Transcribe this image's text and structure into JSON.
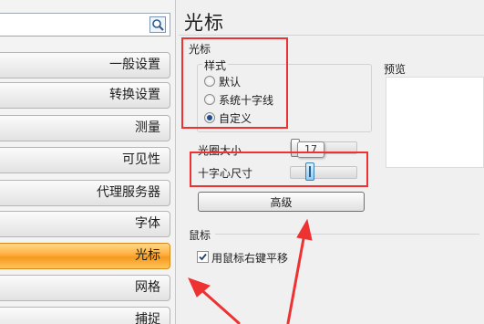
{
  "search": {
    "value": "",
    "placeholder": ""
  },
  "nav": {
    "items": [
      {
        "label": "一般设置"
      },
      {
        "label": "转换设置"
      },
      {
        "label": "测量"
      },
      {
        "label": "可见性"
      },
      {
        "label": "代理服务器"
      },
      {
        "label": "字体"
      },
      {
        "label": "光标",
        "selected": true
      },
      {
        "label": "网格"
      },
      {
        "label": "捕捉"
      }
    ]
  },
  "page": {
    "title": "光标"
  },
  "cursor_section": {
    "title": "光标",
    "style_group": {
      "title": "样式",
      "options": [
        {
          "label": "默认",
          "checked": false
        },
        {
          "label": "系统十字线",
          "checked": false
        },
        {
          "label": "自定义",
          "checked": true
        }
      ]
    },
    "preview_label": "预览",
    "aperture_label": "光圈大小",
    "crosshair_label": "十字心尺寸",
    "aperture_tooltip": "17",
    "advanced_button": "高级"
  },
  "mouse_section": {
    "title": "鼠标",
    "pan_checkbox": {
      "label": "用鼠标右键平移",
      "checked": true
    }
  },
  "colors": {
    "selected_nav": "#ffae3c",
    "annotation_red": "#ee3232",
    "radio_dot": "#1d4e8f"
  }
}
